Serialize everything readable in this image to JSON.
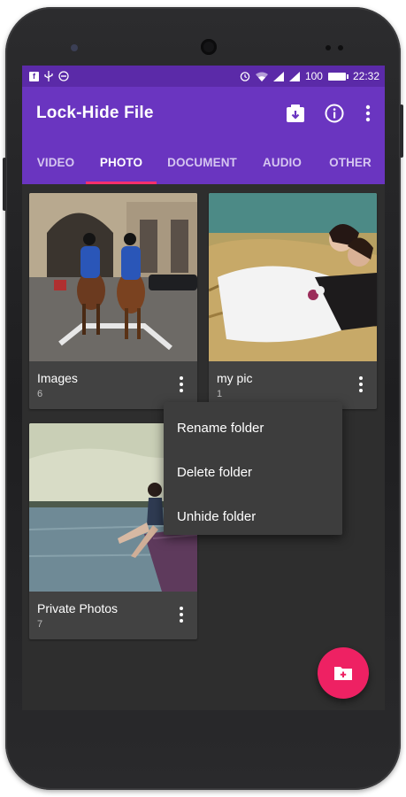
{
  "statusbar": {
    "left_icons": [
      "facebook-icon",
      "usb-icon",
      "do-not-disturb-icon"
    ],
    "battery_percent": "100",
    "time": "22:32"
  },
  "appbar": {
    "title": "Lock-Hide File",
    "actions": [
      "download-box-icon",
      "info-icon",
      "more-vert-icon"
    ]
  },
  "tabs": [
    {
      "label": "VIDEO",
      "active": false
    },
    {
      "label": "PHOTO",
      "active": true
    },
    {
      "label": "DOCUMENT",
      "active": false
    },
    {
      "label": "AUDIO",
      "active": false
    },
    {
      "label": "OTHER",
      "active": false
    }
  ],
  "folders": [
    {
      "name": "Images",
      "count": "6"
    },
    {
      "name": "my pic",
      "count": "1"
    },
    {
      "name": "Private Photos",
      "count": "7"
    }
  ],
  "context_menu": {
    "items": [
      "Rename folder",
      "Delete folder",
      "Unhide folder"
    ]
  },
  "fab": {
    "icon": "create-folder-icon"
  },
  "colors": {
    "statusbar": "#5b2aa8",
    "appbar": "#6a35c0",
    "tab_indicator": "#ff2f6d",
    "fab": "#ee2163",
    "background": "#2e2e2e",
    "card": "#424242"
  }
}
